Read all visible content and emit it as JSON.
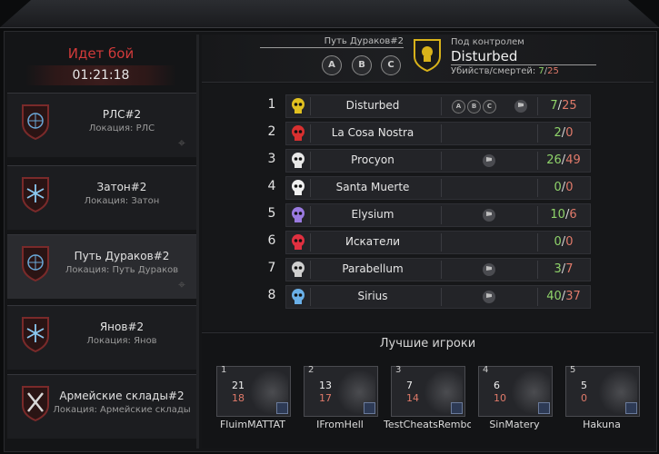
{
  "battle": {
    "status": "Идет бой",
    "timer": "01:21:18"
  },
  "locations": [
    {
      "name": "РЛС#2",
      "sub": "Локация: РЛС",
      "active": false,
      "emblem": "globe-emblem-icon"
    },
    {
      "name": "Затон#2",
      "sub": "Локация: Затон",
      "active": false,
      "emblem": "snowflake-emblem-icon"
    },
    {
      "name": "Путь Дураков#2",
      "sub": "Локация: Путь Дураков",
      "active": true,
      "emblem": "globe-emblem-icon"
    },
    {
      "name": "Янов#2",
      "sub": "Локация: Янов",
      "active": false,
      "emblem": "snowflake-emblem-icon"
    },
    {
      "name": "Армейские склады#2",
      "sub": "Локация: Армейские склады",
      "active": false,
      "emblem": "crossed-swords-emblem-icon"
    }
  ],
  "header": {
    "location": "Путь Дураков#2",
    "points": [
      "A",
      "B",
      "C"
    ],
    "control_label": "Под контролем",
    "controlling_clan": "Disturbed",
    "kd_label": "Убийств/смертей:",
    "kills": "7",
    "deaths": "25"
  },
  "standings": [
    {
      "rank": "1",
      "clan": "Disturbed",
      "icon": "yellow-skull-icon",
      "points": [
        "A",
        "B",
        "C"
      ],
      "flag": true,
      "kills": "7",
      "deaths": "25"
    },
    {
      "rank": "2",
      "clan": "La Cosa Nostra",
      "icon": "red-skull-icon",
      "points": [],
      "flag": false,
      "kills": "2",
      "deaths": "0"
    },
    {
      "rank": "3",
      "clan": "Procyon",
      "icon": "white-wing-icon",
      "points": [],
      "flag": true,
      "kills": "26",
      "deaths": "49"
    },
    {
      "rank": "4",
      "clan": "Santa Muerte",
      "icon": "white-skull-icon",
      "points": [],
      "flag": false,
      "kills": "0",
      "deaths": "0"
    },
    {
      "rank": "5",
      "clan": "Elysium",
      "icon": "purple-skull-icon",
      "points": [],
      "flag": true,
      "kills": "10",
      "deaths": "6"
    },
    {
      "rank": "6",
      "clan": "Искатели",
      "icon": "red-star-icon",
      "points": [],
      "flag": false,
      "kills": "0",
      "deaths": "0"
    },
    {
      "rank": "7",
      "clan": "Parabellum",
      "icon": "silver-wings-icon",
      "points": [],
      "flag": true,
      "kills": "3",
      "deaths": "7"
    },
    {
      "rank": "8",
      "clan": "Sirius",
      "icon": "blue-snowflake-icon",
      "points": [],
      "flag": true,
      "kills": "40",
      "deaths": "37"
    }
  ],
  "best_players": {
    "title": "Лучшие игроки",
    "players": [
      {
        "rank": "1",
        "kills": "21",
        "deaths": "18",
        "name": "FluimMATTAT"
      },
      {
        "rank": "2",
        "kills": "13",
        "deaths": "17",
        "name": "IFromHell"
      },
      {
        "rank": "3",
        "kills": "7",
        "deaths": "14",
        "name": "TestCheatsRembov"
      },
      {
        "rank": "4",
        "kills": "6",
        "deaths": "10",
        "name": "SinMatery"
      },
      {
        "rank": "5",
        "kills": "5",
        "deaths": "0",
        "name": "Hakuna"
      }
    ]
  },
  "colors": {
    "status_red": "#d23a3a",
    "kills_green": "#8fd36a",
    "deaths_red": "#e07a6a",
    "accent_gold": "#d8b21a"
  }
}
